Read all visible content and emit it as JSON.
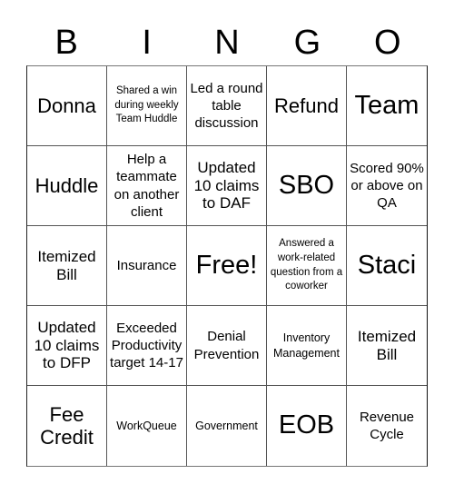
{
  "header": {
    "letters": [
      "B",
      "I",
      "N",
      "G",
      "O"
    ]
  },
  "board": {
    "cells": [
      "Donna",
      "Shared a win during weekly Team Huddle",
      "Led a round table discussion",
      "Refund",
      "Team",
      "Huddle",
      "Help a teammate on another client",
      "Updated 10 claims to DAF",
      "SBO",
      "Scored 90% or above on QA",
      "Itemized Bill",
      "Insurance",
      "Free!",
      "Answered a work-related question from a coworker",
      "Staci",
      "Updated 10 claims to DFP",
      "Exceeded Productivity target 14-17",
      "Denial Prevention",
      "Inventory Management",
      "Itemized Bill",
      "Fee Credit",
      "WorkQueue",
      "Government",
      "EOB",
      "Revenue Cycle"
    ],
    "free_space_index": 12
  }
}
